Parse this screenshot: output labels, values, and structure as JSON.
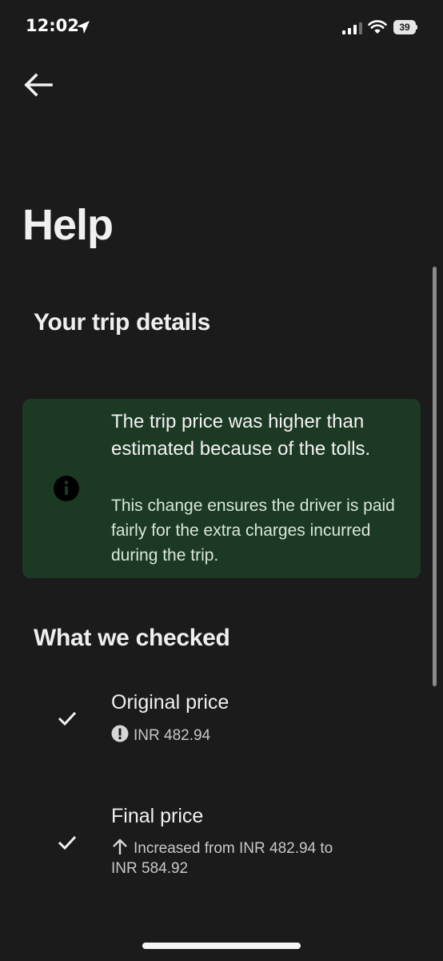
{
  "status_bar": {
    "time": "12:02",
    "battery": "39"
  },
  "page": {
    "title": "Help"
  },
  "trip_details": {
    "heading": "Your trip details",
    "info_card": {
      "headline": "The trip price was higher than estimated because of the tolls.",
      "body": "This change ensures the driver is paid fairly for the extra charges incurred during the trip."
    }
  },
  "what_we_checked": {
    "heading": "What we checked",
    "items": [
      {
        "title": "Original price",
        "detail": "INR 482.94",
        "detail_icon": "alert-circle-icon"
      },
      {
        "title": "Final price",
        "detail_line1": "Increased from  INR 482.94 to",
        "detail_line2": "INR 584.92",
        "detail_icon": "arrow-up-icon"
      }
    ]
  },
  "colors": {
    "background": "#1b1b1b",
    "info_card": "#1c3a23",
    "text": "#f2f2f2"
  }
}
